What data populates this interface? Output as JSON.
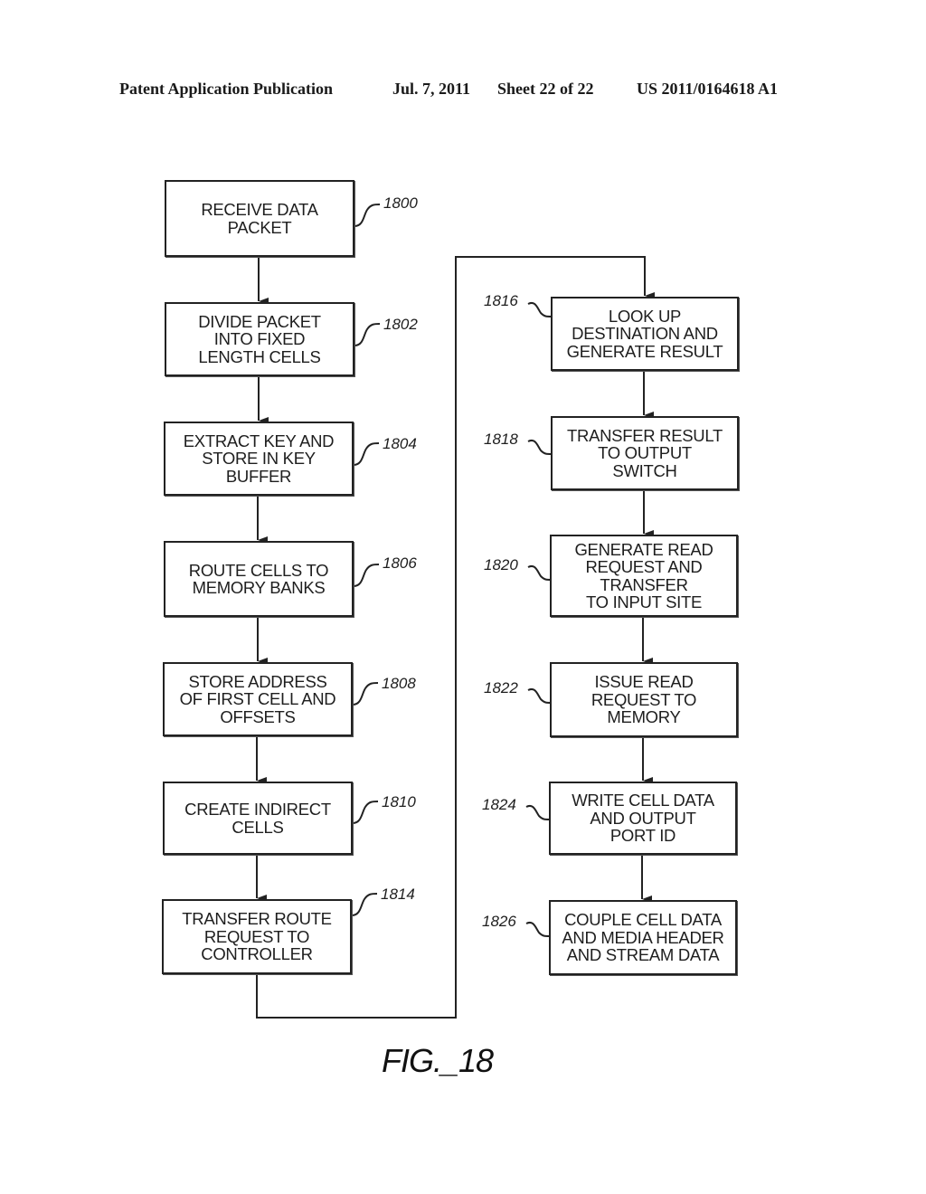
{
  "header": {
    "publication": "Patent Application Publication",
    "date": "Jul. 7, 2011",
    "sheet": "Sheet 22 of 22",
    "number": "US 2011/0164618 A1"
  },
  "flowchart": {
    "left_column": [
      {
        "ref": "1800",
        "text": "RECEIVE DATA\nPACKET"
      },
      {
        "ref": "1802",
        "text": "DIVIDE PACKET\nINTO FIXED\nLENGTH CELLS"
      },
      {
        "ref": "1804",
        "text": "EXTRACT KEY AND\nSTORE IN KEY\nBUFFER"
      },
      {
        "ref": "1806",
        "text": "ROUTE CELLS TO\nMEMORY BANKS"
      },
      {
        "ref": "1808",
        "text": "STORE ADDRESS\nOF FIRST CELL AND\nOFFSETS"
      },
      {
        "ref": "1810",
        "text": "CREATE INDIRECT\nCELLS"
      },
      {
        "ref": "1814",
        "text": "TRANSFER ROUTE\nREQUEST TO\nCONTROLLER"
      }
    ],
    "right_column": [
      {
        "ref": "1816",
        "text": "LOOK UP\nDESTINATION AND\nGENERATE RESULT"
      },
      {
        "ref": "1818",
        "text": "TRANSFER RESULT\nTO OUTPUT\nSWITCH"
      },
      {
        "ref": "1820",
        "text": "GENERATE READ\nREQUEST AND\nTRANSFER\nTO INPUT SITE"
      },
      {
        "ref": "1822",
        "text": "ISSUE READ\nREQUEST TO\nMEMORY"
      },
      {
        "ref": "1824",
        "text": "WRITE CELL DATA\nAND OUTPUT\nPORT ID"
      },
      {
        "ref": "1826",
        "text": "COUPLE CELL DATA\nAND MEDIA HEADER\nAND STREAM DATA"
      }
    ]
  },
  "figure_label": "FIG._18"
}
